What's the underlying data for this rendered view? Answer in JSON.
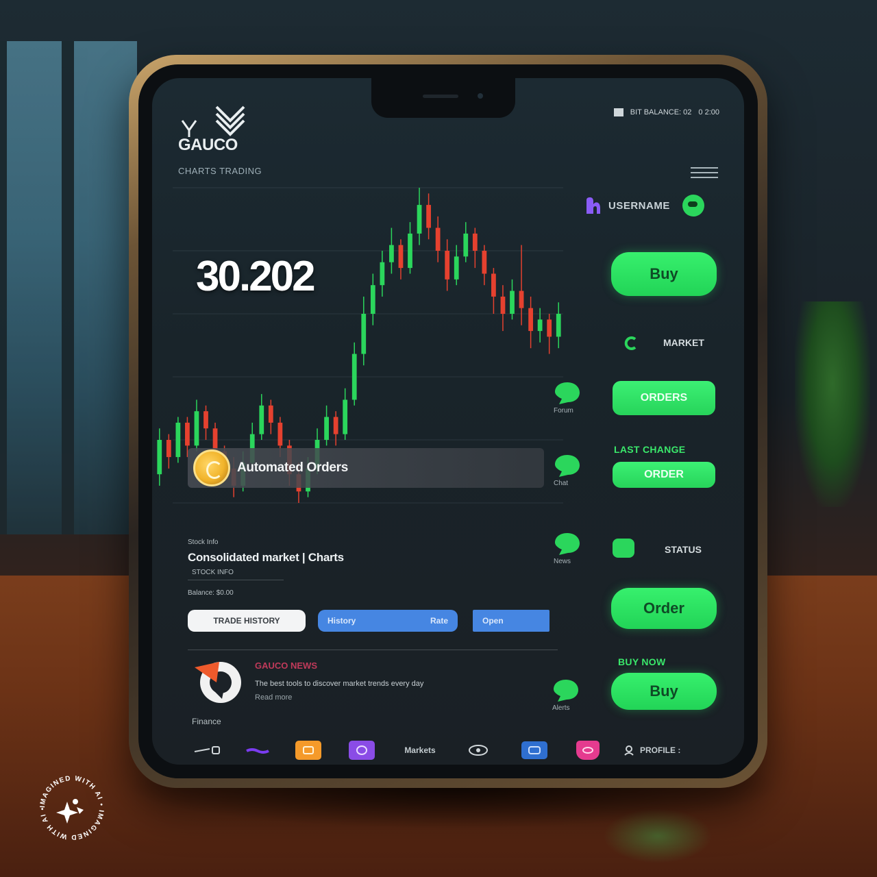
{
  "app": {
    "logo_text": "GAUCO",
    "tagline": "CHARTS TRADING",
    "status_text": "BIT BALANCE: 02",
    "status_right": "0 2:00"
  },
  "ticker": {
    "price": "30.202"
  },
  "account": {
    "username": "USERNAME"
  },
  "actions": {
    "buy_label": "Buy",
    "market_label": "MARKET",
    "orders_label": "ORDERS",
    "last_change_caption": "LAST CHANGE",
    "order_label": "ORDER",
    "status_label": "STATUS",
    "order_big_label": "Order",
    "buy_now_caption": "BUY NOW",
    "buy2_label": "Buy"
  },
  "bubbles": {
    "b1": "Forum",
    "b2": "Chat",
    "b3": "News",
    "b4": "Alerts"
  },
  "alert": {
    "text": "Automated Orders"
  },
  "info": {
    "small_top": "Stock Info",
    "title": "Consolidated market | Charts",
    "subtitle": "STOCK INFO",
    "label2": "Balance: $0.00"
  },
  "pills": {
    "white": "TRADE HISTORY",
    "blue1_left": "History",
    "blue1_right": "Rate",
    "blue2": "Open"
  },
  "news": {
    "heading": "GAUCO NEWS",
    "line1": "The best tools to discover market trends every day",
    "line2": "Read more",
    "source": "Finance"
  },
  "bottom_nav": {
    "market_text": "Markets",
    "profile_text": "PROFILE :"
  },
  "watermark": {
    "text": "IMAGINED WITH AI • IMAGINED WITH AI •"
  },
  "colors": {
    "up": "#2bd65c",
    "down": "#e5412f",
    "accent": "#2bd65c"
  },
  "chart_data": {
    "type": "candlestick",
    "title": "",
    "candles": [
      {
        "o": 5,
        "c": 11,
        "h": 13,
        "l": 3
      },
      {
        "o": 11,
        "c": 8,
        "h": 12,
        "l": 6
      },
      {
        "o": 8,
        "c": 14,
        "h": 15,
        "l": 7
      },
      {
        "o": 14,
        "c": 10,
        "h": 15,
        "l": 8
      },
      {
        "o": 10,
        "c": 16,
        "h": 18,
        "l": 9
      },
      {
        "o": 16,
        "c": 13,
        "h": 17,
        "l": 11
      },
      {
        "o": 13,
        "c": 9,
        "h": 14,
        "l": 7
      },
      {
        "o": 9,
        "c": 6,
        "h": 10,
        "l": 4
      },
      {
        "o": 6,
        "c": 3,
        "h": 8,
        "l": 1
      },
      {
        "o": 3,
        "c": 7,
        "h": 9,
        "l": 2
      },
      {
        "o": 7,
        "c": 12,
        "h": 14,
        "l": 6
      },
      {
        "o": 12,
        "c": 17,
        "h": 19,
        "l": 11
      },
      {
        "o": 17,
        "c": 14,
        "h": 18,
        "l": 12
      },
      {
        "o": 14,
        "c": 10,
        "h": 15,
        "l": 8
      },
      {
        "o": 10,
        "c": 5,
        "h": 11,
        "l": 3
      },
      {
        "o": 5,
        "c": 2,
        "h": 7,
        "l": 0
      },
      {
        "o": 2,
        "c": 6,
        "h": 8,
        "l": 1
      },
      {
        "o": 6,
        "c": 11,
        "h": 13,
        "l": 5
      },
      {
        "o": 11,
        "c": 15,
        "h": 17,
        "l": 10
      },
      {
        "o": 15,
        "c": 12,
        "h": 16,
        "l": 10
      },
      {
        "o": 12,
        "c": 18,
        "h": 20,
        "l": 11
      },
      {
        "o": 18,
        "c": 26,
        "h": 28,
        "l": 17
      },
      {
        "o": 26,
        "c": 33,
        "h": 36,
        "l": 24
      },
      {
        "o": 33,
        "c": 38,
        "h": 40,
        "l": 31
      },
      {
        "o": 38,
        "c": 42,
        "h": 44,
        "l": 36
      },
      {
        "o": 42,
        "c": 45,
        "h": 48,
        "l": 40
      },
      {
        "o": 45,
        "c": 41,
        "h": 46,
        "l": 39
      },
      {
        "o": 41,
        "c": 47,
        "h": 49,
        "l": 40
      },
      {
        "o": 47,
        "c": 52,
        "h": 55,
        "l": 45
      },
      {
        "o": 52,
        "c": 48,
        "h": 54,
        "l": 46
      },
      {
        "o": 48,
        "c": 44,
        "h": 50,
        "l": 42
      },
      {
        "o": 44,
        "c": 39,
        "h": 46,
        "l": 37
      },
      {
        "o": 39,
        "c": 43,
        "h": 45,
        "l": 38
      },
      {
        "o": 43,
        "c": 47,
        "h": 49,
        "l": 42
      },
      {
        "o": 47,
        "c": 44,
        "h": 48,
        "l": 41
      },
      {
        "o": 44,
        "c": 40,
        "h": 45,
        "l": 38
      },
      {
        "o": 40,
        "c": 36,
        "h": 41,
        "l": 33
      },
      {
        "o": 36,
        "c": 33,
        "h": 38,
        "l": 30
      },
      {
        "o": 33,
        "c": 37,
        "h": 39,
        "l": 32
      },
      {
        "o": 37,
        "c": 34,
        "h": 45,
        "l": 31
      },
      {
        "o": 34,
        "c": 30,
        "h": 36,
        "l": 27
      },
      {
        "o": 30,
        "c": 32,
        "h": 34,
        "l": 28
      },
      {
        "o": 32,
        "c": 29,
        "h": 33,
        "l": 26
      },
      {
        "o": 29,
        "c": 33,
        "h": 35,
        "l": 27
      }
    ]
  }
}
